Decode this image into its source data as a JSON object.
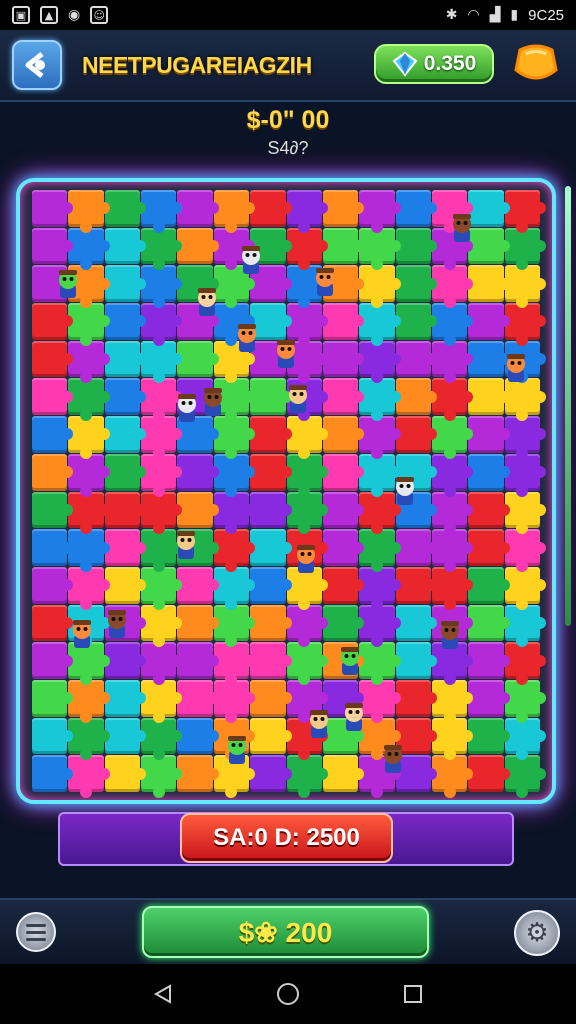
{
  "status_bar": {
    "time": "9C25",
    "left_icons": [
      "image-icon",
      "gallery-icon",
      "sync-icon",
      "message-icon"
    ],
    "right_icons": [
      "bluetooth-icon",
      "wifi-icon",
      "signal-icon",
      "battery-icon"
    ]
  },
  "header": {
    "title": "NEETPUGAREIAGZIH",
    "coins": "0.350",
    "coin_icon": "gem-icon",
    "back_icon": "back-arrow-icon",
    "star_icon": "star-badge-icon"
  },
  "score": {
    "main": "$-0\" 00",
    "sub": "S4∂?"
  },
  "board": {
    "rows": 16,
    "cols": 14,
    "palette": [
      "#e8262c",
      "#1fb24a",
      "#1e7ee8",
      "#ffd21e",
      "#b42ad8",
      "#ff8a1e",
      "#19c8d6",
      "#ff3ab0",
      "#8a2ae0",
      "#42d84a"
    ],
    "characters": 22
  },
  "bid": {
    "label": "SA:0 D: 2500"
  },
  "footer": {
    "cash_label": "$❀ 200",
    "menu_icon": "menu-icon",
    "settings_icon": "settings-gear-icon"
  },
  "nav": {
    "back_icon": "nav-back-icon",
    "home_icon": "nav-home-icon",
    "recents_icon": "nav-recents-icon"
  }
}
